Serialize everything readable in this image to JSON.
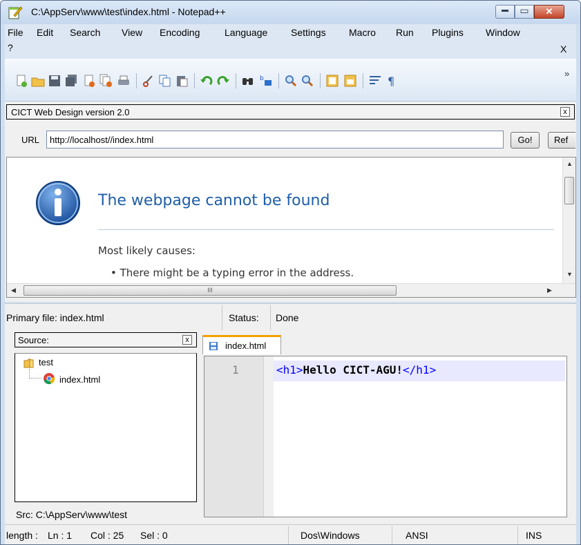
{
  "window": {
    "title": "C:\\AppServ\\www\\test\\index.html - Notepad++",
    "minimize": "▬",
    "maximize": "▭",
    "close": "✕"
  },
  "menu": {
    "items": [
      "File",
      "Edit",
      "Search",
      "View",
      "Encoding",
      "Language",
      "Settings",
      "Macro",
      "Run",
      "Plugins",
      "Window"
    ],
    "help": "?",
    "close": "X"
  },
  "toolbar": {
    "overflow": "»",
    "icons": [
      "new-file-icon",
      "open-file-icon",
      "save-icon",
      "save-all-icon",
      "close-icon",
      "close-all-icon",
      "print-icon",
      "cut-icon",
      "copy-icon",
      "paste-icon",
      "undo-icon",
      "redo-icon",
      "find-icon",
      "replace-icon",
      "zoom-in-icon",
      "zoom-out-icon",
      "sync-vertical-icon",
      "sync-horizontal-icon",
      "word-wrap-icon",
      "show-all-characters-icon"
    ]
  },
  "plugin": {
    "title": "CICT Web Design version 2.0",
    "close": "x",
    "url_label": "URL",
    "url_value": "http://localhost//index.html",
    "go_label": "Go!",
    "refresh_label": "Ref"
  },
  "browser": {
    "error_title": "The webpage cannot be found",
    "causes_heading": "Most likely causes:",
    "cause_1": "There might be a typing error in the address.",
    "hscroll_grip": "III"
  },
  "plugin_status": {
    "primary_file": "Primary file: index.html",
    "status_label": "Status:",
    "status_value": "Done"
  },
  "source": {
    "header": "Source:",
    "close": "x",
    "folder": "test",
    "file": "index.html",
    "src_path": "Src: C:\\AppServ\\www\\test"
  },
  "editor": {
    "tab_label": "index.html",
    "line_number": "1",
    "code": {
      "open_tag": "<h1>",
      "text": "Hello CICT-AGU!",
      "close_tag": "</h1>"
    }
  },
  "statusbar": {
    "length": "length :",
    "ln": "Ln : 1",
    "col": "Col : 25",
    "sel": "Sel : 0",
    "eol": "Dos\\Windows",
    "encoding": "ANSI",
    "mode": "INS"
  },
  "colors": {
    "accent_tab": "#f5a100",
    "tag": "#0000ff",
    "error_title": "#1f5ea8"
  }
}
